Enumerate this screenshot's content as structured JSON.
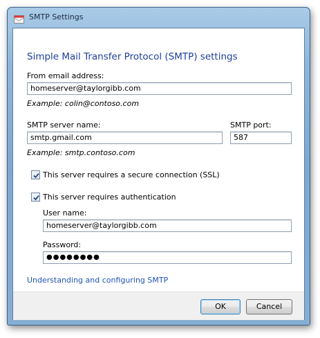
{
  "window": {
    "title": "SMTP Settings"
  },
  "dialog": {
    "heading": "Simple Mail Transfer Protocol (SMTP) settings",
    "from_email": {
      "label": "From email address:",
      "value": "homeserver@taylorgibb.com",
      "example": "Example: colin@contoso.com"
    },
    "smtp_server": {
      "label": "SMTP server name:",
      "value": "smtp.gmail.com",
      "example": "Example: smtp.contoso.com"
    },
    "smtp_port": {
      "label": "SMTP port:",
      "value": "587"
    },
    "ssl": {
      "label": "This server requires a secure connection (SSL)",
      "checked": true
    },
    "auth": {
      "label": "This server requires authentication",
      "checked": true
    },
    "username": {
      "label": "User name:",
      "value": "homeserver@taylorgibb.com"
    },
    "password": {
      "label": "Password:",
      "value": "●●●●●●●●"
    },
    "help_link": "Understanding and configuring SMTP"
  },
  "buttons": {
    "ok": "OK",
    "cancel": "Cancel"
  },
  "colors": {
    "heading": "#1e3f99",
    "link": "#1f55b3",
    "frame": "#8fb6d9"
  }
}
